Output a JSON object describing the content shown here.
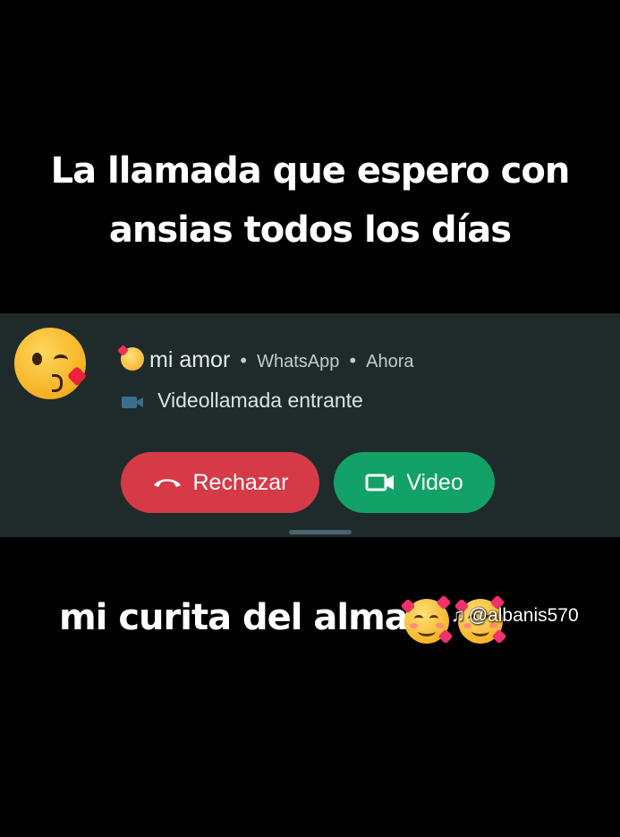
{
  "captions": {
    "top_line1": "La llamada que espero con",
    "top_line2": "ansias todos los días",
    "bottom": "mi curita del alma"
  },
  "watermark": {
    "handle": "@albanis570",
    "icon": "tiktok-icon"
  },
  "notification": {
    "avatar_icon": "face-blowing-a-kiss-icon",
    "contact_emoji_icon": "smiling-face-with-hearts-icon",
    "contact_name": "mi amor",
    "app_name": "WhatsApp",
    "time": "Ahora",
    "separator": "•",
    "subtitle_icon": "video-camera-icon",
    "subtitle": "Videollamada entrante",
    "reject_label": "Rechazar",
    "reject_icon": "hang-up-phone-icon",
    "video_label": "Video",
    "video_icon": "video-camera-icon"
  },
  "colors": {
    "background": "#000000",
    "notification_bg": "#1f2b2a",
    "reject": "#d63a47",
    "video": "#12a267"
  }
}
